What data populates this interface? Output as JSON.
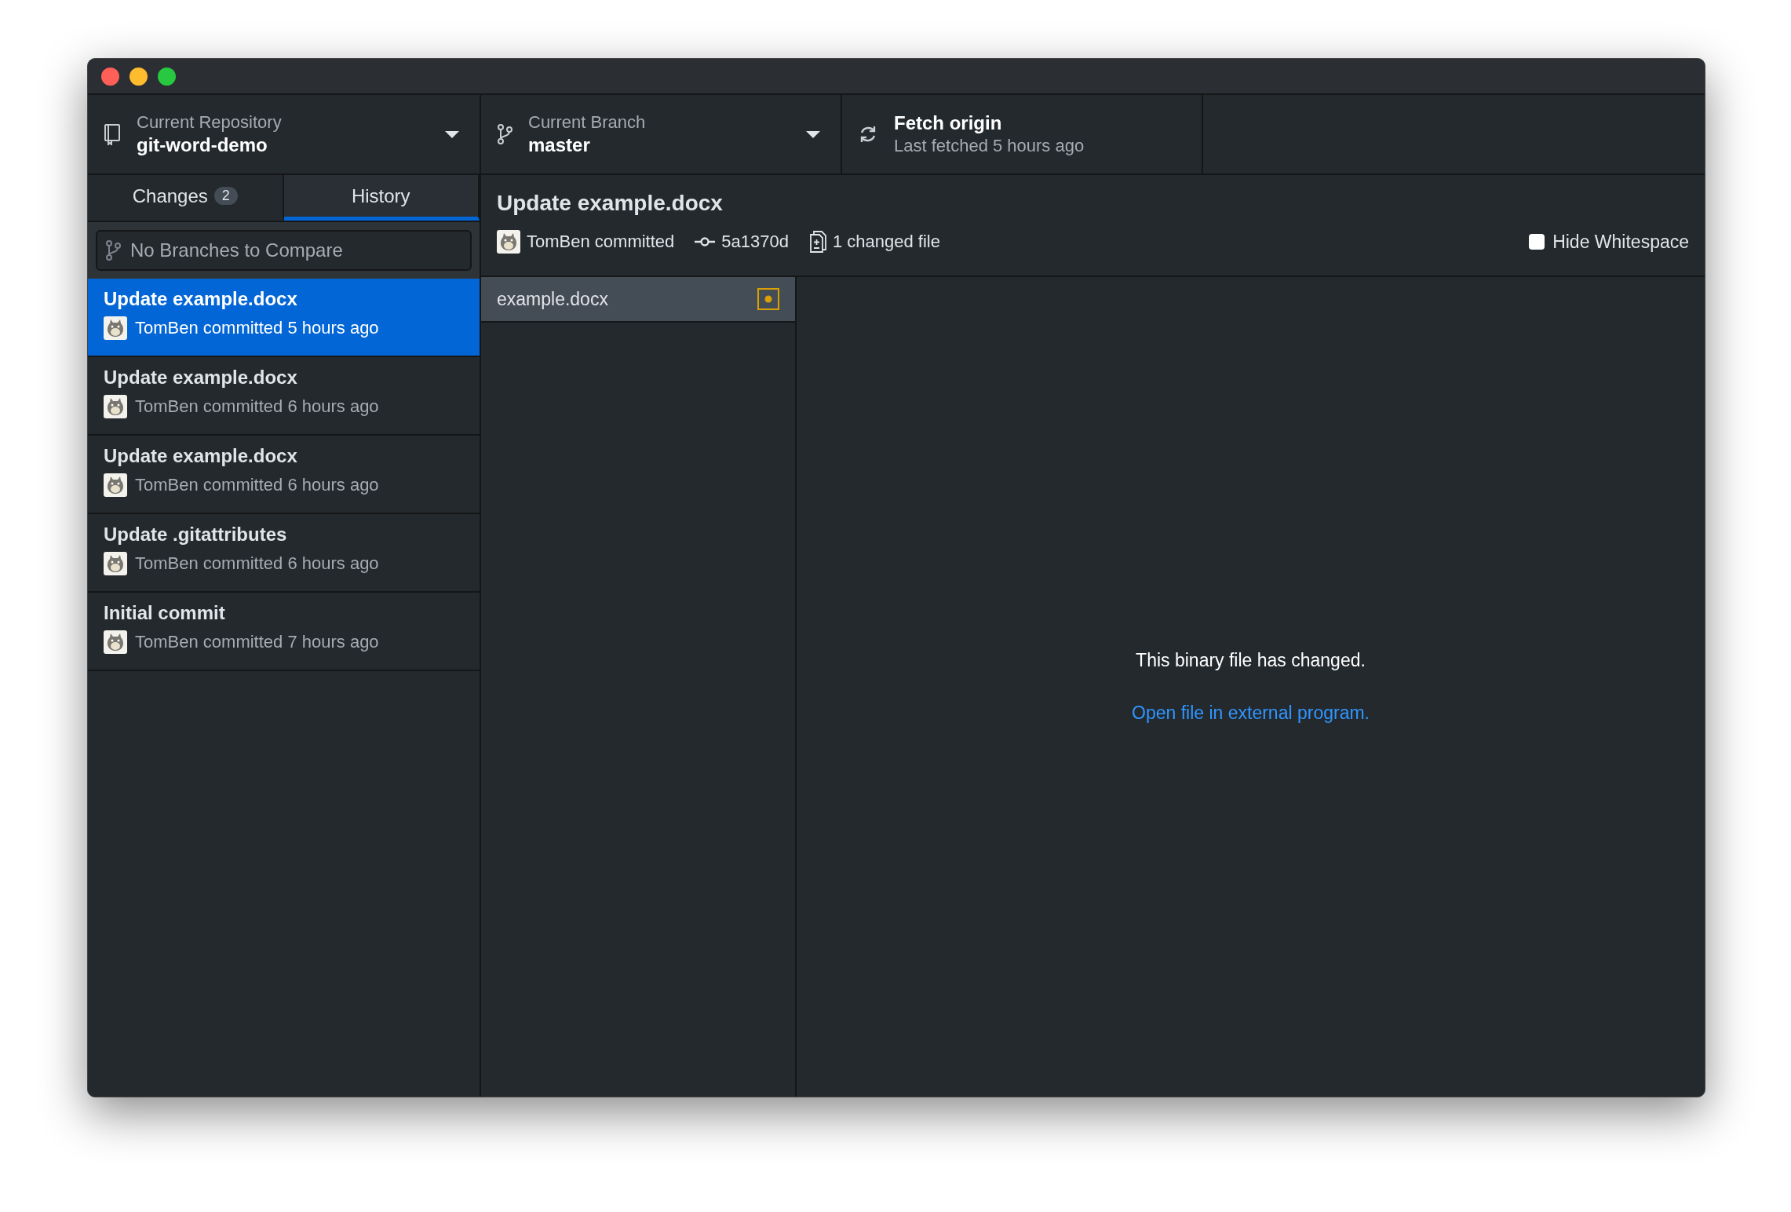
{
  "toolbar": {
    "repository": {
      "label": "Current Repository",
      "value": "git-word-demo"
    },
    "branch": {
      "label": "Current Branch",
      "value": "master"
    },
    "fetch": {
      "title": "Fetch origin",
      "subtitle": "Last fetched 5 hours ago"
    }
  },
  "sidebar": {
    "tabs": [
      {
        "label": "Changes",
        "count": "2",
        "selected": false
      },
      {
        "label": "History",
        "selected": true
      }
    ],
    "compare": {
      "placeholder": "No Branches to Compare"
    },
    "commits": [
      {
        "title": "Update example.docx",
        "meta": "TomBen committed 5 hours ago",
        "selected": true
      },
      {
        "title": "Update example.docx",
        "meta": "TomBen committed 6 hours ago",
        "selected": false
      },
      {
        "title": "Update example.docx",
        "meta": "TomBen committed 6 hours ago",
        "selected": false
      },
      {
        "title": "Update .gitattributes",
        "meta": "TomBen committed 6 hours ago",
        "selected": false
      },
      {
        "title": "Initial commit",
        "meta": "TomBen committed 7 hours ago",
        "selected": false
      }
    ]
  },
  "commit_detail": {
    "title": "Update example.docx",
    "author": "TomBen committed",
    "sha": "5a1370d",
    "changed_files": "1 changed file",
    "hide_whitespace": {
      "label": "Hide Whitespace",
      "checked": false
    }
  },
  "files": [
    {
      "name": "example.docx",
      "kind": "modified",
      "selected": true
    }
  ],
  "diff": {
    "message": "This binary file has changed.",
    "link": "Open file in external program."
  }
}
